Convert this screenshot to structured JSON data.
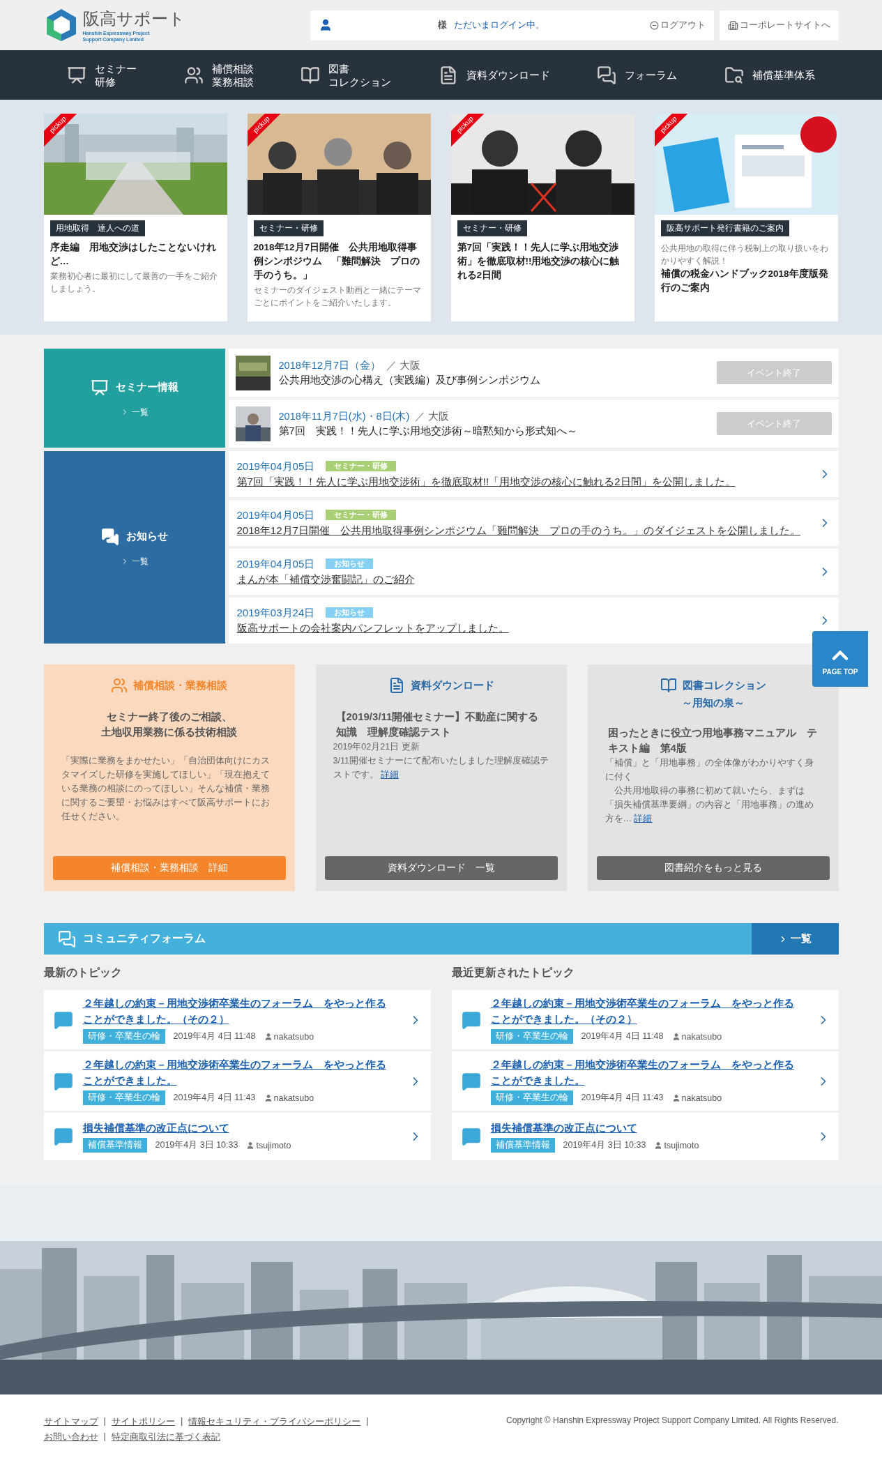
{
  "header": {
    "logo": {
      "name": "阪高サポート",
      "sub": "Hanshin Expressway Project Support Company Limited"
    },
    "user_bar": {
      "honorific": "様",
      "status": "ただいまログイン中。",
      "logout": "ログアウト"
    },
    "corporate_link": "コーポレートサイトへ"
  },
  "nav": {
    "items": [
      {
        "lines": [
          "セミナー",
          "研修"
        ]
      },
      {
        "lines": [
          "補償相談",
          "業務相談"
        ]
      },
      {
        "lines": [
          "図書",
          "コレクション"
        ]
      },
      {
        "lines": [
          "資料ダウンロード"
        ]
      },
      {
        "lines": [
          "フォーラム"
        ]
      },
      {
        "lines": [
          "補償基準体系"
        ]
      }
    ]
  },
  "pickups": [
    {
      "kind": "title_first",
      "badge": "pickup",
      "category": "用地取得　達人への道",
      "title": "序走編　用地交渉はしたことないけれど…",
      "description": "業務初心者に最初にして最善の一手をご紹介しましょう。"
    },
    {
      "kind": "title_first",
      "badge": "pickup",
      "category": "セミナー・研修",
      "title": "2018年12月7日開催　公共用地取得事例シンポジウム　「難問解決　プロの手のうち。」",
      "description": "セミナーのダイジェスト動画と一緒にテーマごとにポイントをご紹介いたします。"
    },
    {
      "kind": "title_first",
      "badge": "pickup",
      "category": "セミナー・研修",
      "title": "第7回「実践！！先人に学ぶ用地交渉術」を徹底取材!!用地交渉の核心に触れる2日間"
    },
    {
      "kind": "description_first",
      "badge": "pickup",
      "category": "阪高サポート発行書籍のご案内",
      "title": "補償の税金ハンドブック2018年度版発行のご案内",
      "description": "公共用地の取得に伴う税制上の取り扱いをわかりやすく解説！"
    }
  ],
  "seminars": {
    "heading": "セミナー情報",
    "more": "一覧",
    "items": [
      {
        "date": "2018年12月7日（金）",
        "place": "／ 大阪",
        "title": "公共用地交渉の心構え（実践編）及び事例シンポジウム",
        "status": "イベント終了",
        "ended": true
      },
      {
        "date": "2018年11月7日(水)・8日(木)",
        "place": "／ 大阪",
        "title": "第7回　実践！！先人に学ぶ用地交渉術～暗黙知から形式知へ～",
        "status": "イベント終了",
        "ended": true
      }
    ]
  },
  "news": {
    "heading": "お知らせ",
    "more": "一覧",
    "items": [
      {
        "date": "2019年04月05日",
        "tag": "セミナー・研修",
        "color": "#a9cf74",
        "title": "第7回「実践！！先人に学ぶ用地交渉術」を徹底取材!!「用地交渉の核心に触れる2日間」を公開しました。"
      },
      {
        "date": "2019年04月05日",
        "tag": "セミナー・研修",
        "color": "#a9cf74",
        "title": "2018年12月7日開催　公共用地取得事例シンポジウム「難問解決　プロの手のうち。」のダイジェストを公開しました。"
      },
      {
        "date": "2019年04月05日",
        "tag": "お知らせ",
        "color": "#84cff2",
        "title": "まんが本「補償交渉奮闘記」のご紹介"
      },
      {
        "date": "2019年03月24日",
        "tag": "お知らせ",
        "color": "#84cff2",
        "title": "阪高サポートの会社案内パンフレットをアップしました。"
      }
    ]
  },
  "boxes": [
    {
      "kind": "accent",
      "title": "補償相談・業務相談",
      "lead": [
        "セミナー終了後のご相談、",
        "土地収用業務に係る技術相談"
      ],
      "body": "「実際に業務をまかせたい」「自治団体向けにカスタマイズした研修を実施してほしい」「現在抱えている業務の相談にのってほしい」そんな補償・業務に関するご要望・お悩みはすべて阪高サポートにお任せください。",
      "button": "補償相談・業務相談　詳細"
    },
    {
      "kind": "plain",
      "title": "資料ダウンロード",
      "lead": [
        "【2019/3/11開催セミナー】不動産に関する知識　理解度確認テスト"
      ],
      "date": "2019年02月21日 更新",
      "body": "3/11開催セミナーにて配布いたしました理解度確認テストです。 ",
      "link": "詳細",
      "button": "資料ダウンロード　一覧"
    },
    {
      "kind": "plain",
      "title": "図書コレクション",
      "subtitle": "～用知の泉～",
      "lead": [
        "困ったときに役立つ用地事務マニュアル　テキスト編　第4版"
      ],
      "body": [
        "「補償」と「用地事務」の全体像がわかりやすく身に付く",
        "　公共用地取得の事務に初めて就いたら、まずは「損失補償基準要綱」の内容と「用地事務」の進め方を… "
      ],
      "link": "詳細",
      "button": "図書紹介をもっと見る"
    }
  ],
  "forum": {
    "heading": "コミュニティフォーラム",
    "more": "一覧",
    "columns": [
      {
        "heading": "最新のトピック",
        "topics": [
          {
            "title": "２年越しの約束－用地交渉術卒業生のフォーラム　をやっと作ることができました。（その２）",
            "tag": "研修・卒業生の輪",
            "date": "2019年4月 4日 11:48",
            "user": "nakatsubo"
          },
          {
            "title": "２年越しの約束－用地交渉術卒業生のフォーラム　をやっと作ることができました。",
            "tag": "研修・卒業生の輪",
            "date": "2019年4月 4日 11:43",
            "user": "nakatsubo"
          },
          {
            "title": "損失補償基準の改正点について",
            "tag": "補償基準情報",
            "date": "2019年4月 3日 10:33",
            "user": "tsujimoto"
          }
        ]
      },
      {
        "heading": "最近更新されたトピック",
        "topics": [
          {
            "title": "２年越しの約束－用地交渉術卒業生のフォーラム　をやっと作ることができました。（その２）",
            "tag": "研修・卒業生の輪",
            "date": "2019年4月 4日 11:48",
            "user": "nakatsubo"
          },
          {
            "title": "２年越しの約束－用地交渉術卒業生のフォーラム　をやっと作ることができました。",
            "tag": "研修・卒業生の輪",
            "date": "2019年4月 4日 11:43",
            "user": "nakatsubo"
          },
          {
            "title": "損失補償基準の改正点について",
            "tag": "補償基準情報",
            "date": "2019年4月 3日 10:33",
            "user": "tsujimoto"
          }
        ]
      }
    ]
  },
  "page_top": "PAGE TOP",
  "footer": {
    "rows": [
      [
        {
          "label": "サイトマップ",
          "separator": "|"
        },
        {
          "label": "サイトポリシー",
          "separator": "|"
        },
        {
          "label": "情報セキュリティ・プライバシーポリシー",
          "separator": "|"
        }
      ],
      [
        {
          "label": "お問い合わせ",
          "separator": "|"
        },
        {
          "label": "特定商取引法に基づく表記"
        }
      ]
    ],
    "copyright": "Copyright © Hanshin Expressway Project Support Company Limited. All Rights Reserved."
  }
}
